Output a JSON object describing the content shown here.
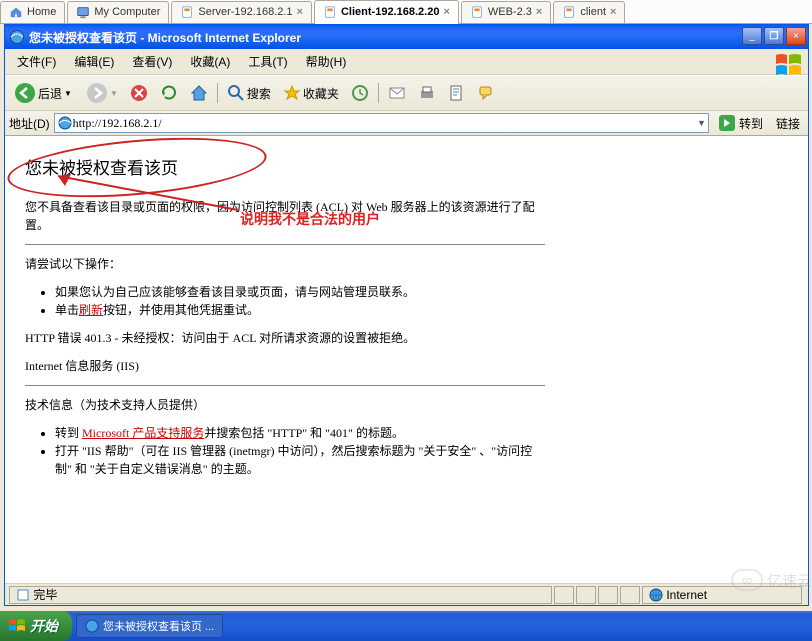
{
  "vm_tabs": [
    {
      "label": "Home",
      "icon": "home",
      "active": false
    },
    {
      "label": "My Computer",
      "icon": "computer",
      "active": false
    },
    {
      "label": "Server-192.168.2.1",
      "icon": "vm",
      "active": false
    },
    {
      "label": "Client-192.168.2.20",
      "icon": "vm",
      "active": true
    },
    {
      "label": "WEB-2.3",
      "icon": "vm",
      "active": false
    },
    {
      "label": "client",
      "icon": "vm",
      "active": false
    }
  ],
  "window_title": "您未被授权查看该页 - Microsoft Internet Explorer",
  "menus": [
    {
      "label": "文件(F)"
    },
    {
      "label": "编辑(E)"
    },
    {
      "label": "查看(V)"
    },
    {
      "label": "收藏(A)"
    },
    {
      "label": "工具(T)"
    },
    {
      "label": "帮助(H)"
    }
  ],
  "toolbar": {
    "back": "后退",
    "search": "搜索",
    "favorites": "收藏夹"
  },
  "address": {
    "label": "地址(D)",
    "url": "http://192.168.2.1/",
    "go": "转到",
    "links": "链接"
  },
  "page": {
    "heading": "您未被授权查看该页",
    "para1": "您不具备查看该目录或页面的权限，因为访问控制列表 (ACL) 对 Web 服务器上的该资源进行了配置。",
    "try_head": "请尝试以下操作：",
    "bullet1": "如果您认为自己应该能够查看该目录或页面，请与网站管理员联系。",
    "bullet2_pre": "单击",
    "bullet2_link": "刷新",
    "bullet2_post": "按钮，并使用其他凭据重试。",
    "err_line": "HTTP 错误 401.3 - 未经授权：访问由于 ACL 对所请求资源的设置被拒绝。",
    "iis_line": "Internet 信息服务 (IIS)",
    "tech_head": "技术信息（为技术支持人员提供）",
    "tech1_pre": "转到",
    "tech1_link": "Microsoft 产品支持服务",
    "tech1_post": "并搜索包括 \"HTTP\" 和 \"401\" 的标题。",
    "tech2": "打开 \"IIS 帮助\"（可在 IIS 管理器 (inetmgr) 中访问），然后搜索标题为 \"关于安全\" 、\"访问控制\" 和 \"关于自定义错误消息\" 的主题。"
  },
  "annotation": "说明我不是合法的用户",
  "status": {
    "done": "完毕",
    "zone": "Internet"
  },
  "taskbar": {
    "start": "开始",
    "task1": "您未被授权查看该页 ..."
  },
  "watermark": "亿速云"
}
